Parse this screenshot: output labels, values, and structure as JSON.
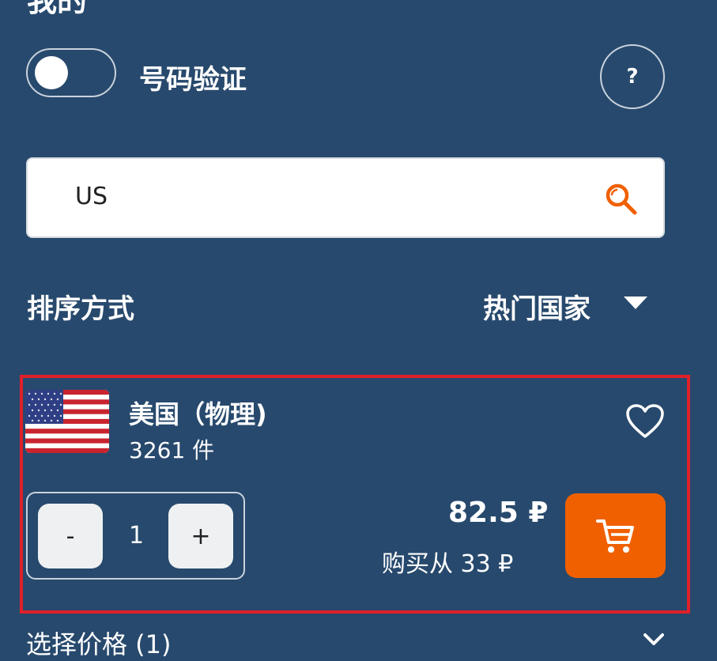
{
  "header": {
    "partial_title": "我的"
  },
  "toggle": {
    "label": "号码验证",
    "state": "off"
  },
  "help": {
    "label": "?"
  },
  "search": {
    "value": "US",
    "icon": "search-icon"
  },
  "sort": {
    "label": "排序方式",
    "value": "热门国家"
  },
  "product": {
    "country": "美国（物理)",
    "count": "3261 件",
    "quantity": {
      "minus": "-",
      "value": "1",
      "plus": "+"
    },
    "price": "82.5 ₽",
    "price_from": "购买从 33 ₽"
  },
  "select_price": {
    "label": "选择价格 (1)"
  },
  "colors": {
    "background": "#27496d",
    "accent": "#f06000",
    "highlight_border": "#e0202a"
  }
}
